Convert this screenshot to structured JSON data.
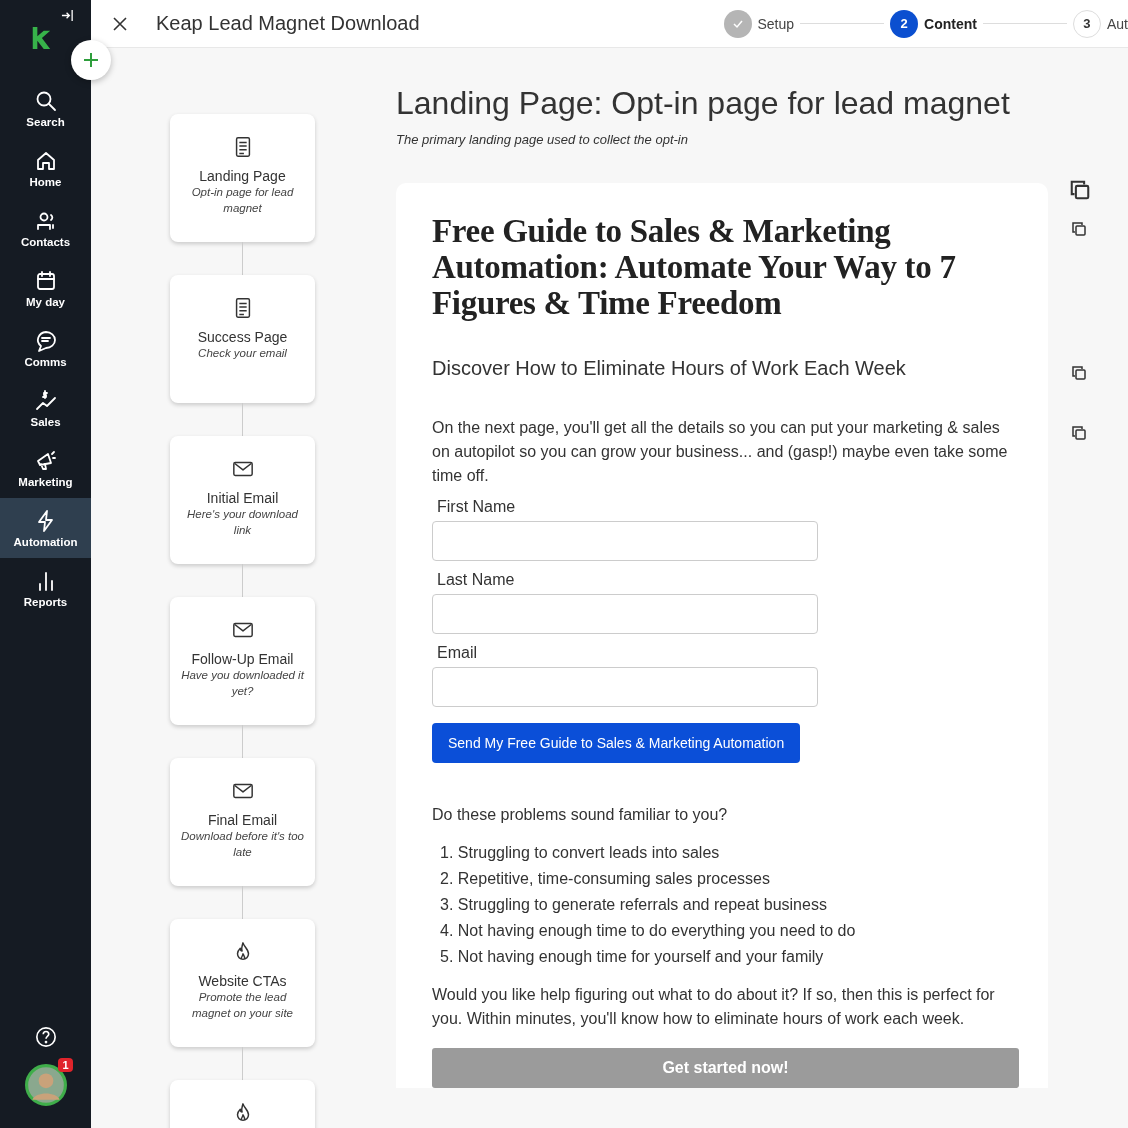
{
  "sidebar": {
    "items": [
      {
        "label": "Search",
        "kind": "search",
        "selected": false
      },
      {
        "label": "Home",
        "kind": "home",
        "selected": false
      },
      {
        "label": "Contacts",
        "kind": "contacts",
        "selected": false
      },
      {
        "label": "My day",
        "kind": "calendar",
        "selected": false
      },
      {
        "label": "Comms",
        "kind": "chat",
        "selected": false
      },
      {
        "label": "Sales",
        "kind": "sales",
        "selected": false
      },
      {
        "label": "Marketing",
        "kind": "megaphone",
        "selected": false
      },
      {
        "label": "Automation",
        "kind": "bolt",
        "selected": true
      },
      {
        "label": "Reports",
        "kind": "bars",
        "selected": false
      }
    ],
    "notification_badge": "1"
  },
  "header": {
    "title": "Keap Lead Magnet Download",
    "steps": [
      {
        "label": "Setup",
        "kind": "done",
        "selected": false
      },
      {
        "number": "2",
        "label": "Content",
        "kind": "current",
        "selected": true
      },
      {
        "number": "3",
        "label": "Aut",
        "kind": "todo",
        "selected": false
      }
    ]
  },
  "flow": {
    "nodes": [
      {
        "kind": "page",
        "title": "Landing Page",
        "subtitle": "Opt-in page for lead magnet"
      },
      {
        "kind": "page",
        "title": "Success Page",
        "subtitle": "Check your email"
      },
      {
        "kind": "email",
        "title": "Initial Email",
        "subtitle": "Here's your download link"
      },
      {
        "kind": "email",
        "title": "Follow-Up Email",
        "subtitle": "Have you downloaded it yet?"
      },
      {
        "kind": "email",
        "title": "Final Email",
        "subtitle": "Download before it's too late"
      },
      {
        "kind": "flame",
        "title": "Website CTAs",
        "subtitle": "Promote the lead magnet on your site"
      },
      {
        "kind": "flame"
      }
    ]
  },
  "editor": {
    "title": "Landing Page: Opt-in page for lead magnet",
    "description": "The primary landing page used to collect the opt-in",
    "preview": {
      "headline": "Free Guide to Sales & Marketing Automation: Automate Your Way to 7 Figures & Time Freedom",
      "subheadline": "Discover How to Eliminate Hours of Work Each Week",
      "intro": "On the next page, you'll get all the details so you can put your marketing & sales on autopilot so you can grow your business... and (gasp!) maybe even take some time off.",
      "fields": [
        {
          "label": "First Name"
        },
        {
          "label": "Last Name"
        },
        {
          "label": "Email"
        }
      ],
      "submit_button": "Send My Free Guide to Sales & Marketing Automation",
      "question": "Do these problems sound familiar to you?",
      "problems": [
        "1. Struggling to convert leads into sales",
        "2. Repetitive, time-consuming sales processes",
        "3. Struggling to generate referrals and repeat business",
        "4. Not having enough time to do everything you need to do",
        "5. Not having enough time for yourself and your family"
      ],
      "closing": "Would you like help figuring out what to do about it? If so, then this is perfect for you. Within minutes, you'll know how to eliminate hours of work each week.",
      "cta_button": "Get started now!"
    }
  }
}
